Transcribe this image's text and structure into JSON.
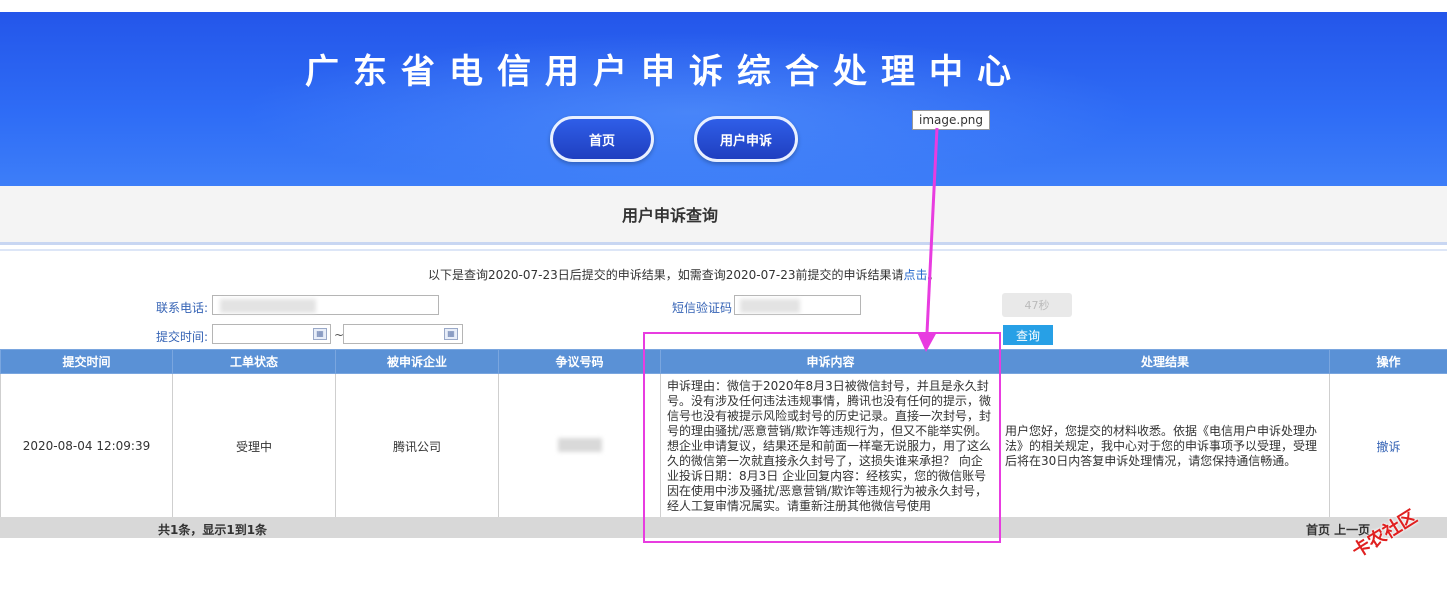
{
  "header": {
    "site_title": "广东省电信用户申诉综合处理中心",
    "nav": [
      {
        "label": "首页"
      },
      {
        "label": "用户申诉"
      }
    ],
    "tooltip": "image.png"
  },
  "subheader": {
    "title": "用户申诉查询"
  },
  "notice": {
    "text": "以下是查询2020-07-23日后提交的申诉结果，如需查询2020-07-23前提交的申诉结果请",
    "link": "点击",
    "suffix": "。"
  },
  "form": {
    "phone_label": "联系电话:",
    "sms_label": "短信验证码",
    "time_label": "提交时间:",
    "range_sep": "~",
    "countdown_label": "47秒",
    "query_label": "查询"
  },
  "table": {
    "columns": [
      "提交时间",
      "工单状态",
      "被申诉企业",
      "争议号码",
      "申诉内容",
      "处理结果",
      "操作"
    ],
    "rows": [
      {
        "submit_time": "2020-08-04 12:09:39",
        "status": "受理中",
        "company": "腾讯公司",
        "content": "申诉理由：微信于2020年8月3日被微信封号，并且是永久封号。没有涉及任何违法违规事情，腾讯也没有任何的提示，微信号也没有被提示风险或封号的历史记录。直接一次封号，封号的理由骚扰/恶意营销/欺诈等违规行为，但又不能举实例。想企业申请复议，结果还是和前面一样毫无说服力，用了这么久的微信第一次就直接永久封号了，这损失谁来承担？ 向企业投诉日期：8月3日 企业回复内容：经核实，您的微信账号因在使用中涉及骚扰/恶意营销/欺诈等违规行为被永久封号，经人工复审情况属实。请重新注册其他微信号使用",
        "result": "用户您好，您提交的材料收悉。依据《电信用户申诉处理办法》的相关规定，我中心对于您的申诉事项予以受理，受理后将在30日内答复申诉处理情况，请您保持通信畅通。",
        "action": "撤诉"
      }
    ]
  },
  "footer": {
    "count_text": "共1条，显示1到1条",
    "pager_text": "首页 上一页"
  },
  "watermark": "卡农社区",
  "colors": {
    "banner": "#2f6df6",
    "table_header": "#5a91d6",
    "highlight": "#e83ce0",
    "query_button": "#27a0e6"
  }
}
